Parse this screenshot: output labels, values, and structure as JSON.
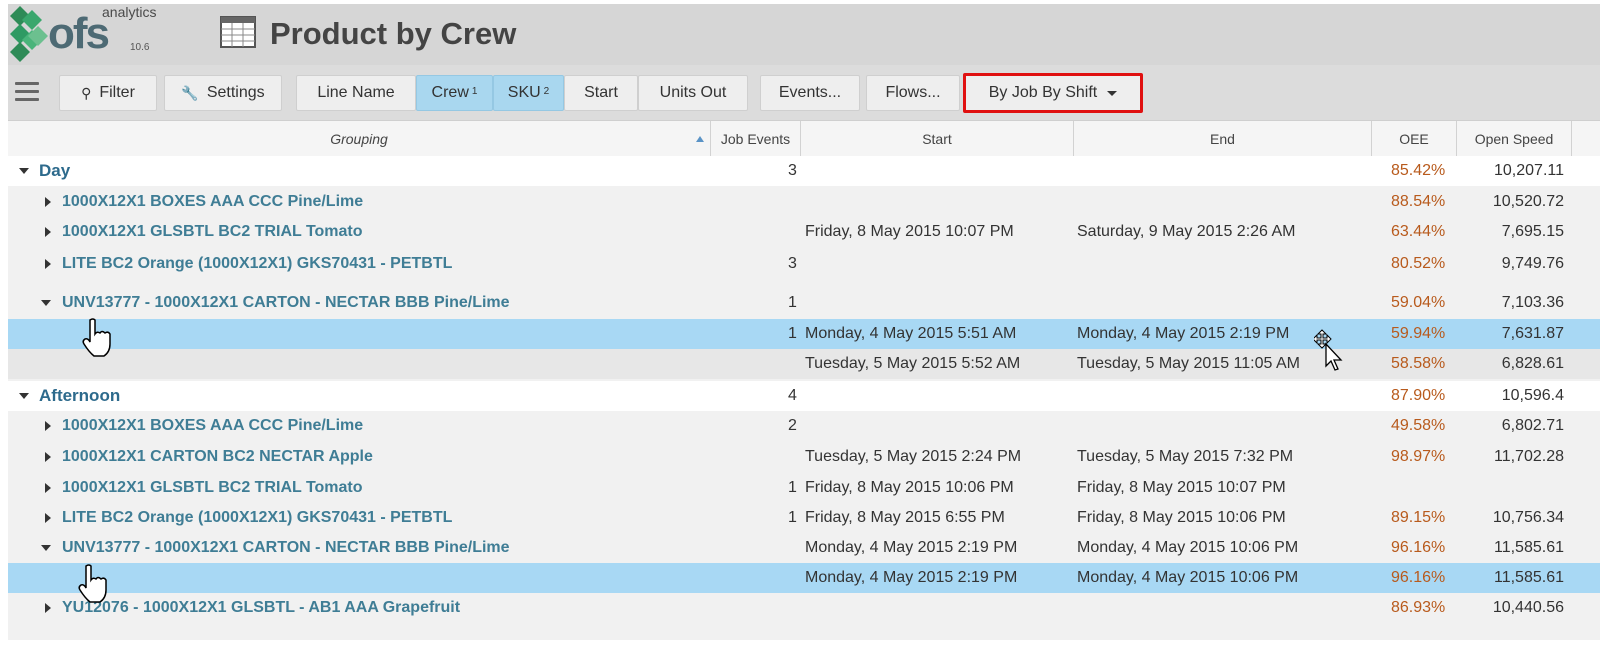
{
  "header": {
    "logo_text": "ofs",
    "logo_sup": "analytics",
    "version": "10.6",
    "title": "Product by Crew"
  },
  "toolbar": {
    "filter": "Filter",
    "settings": "Settings",
    "line_name": "Line Name",
    "crew": "Crew",
    "crew_sup": "1",
    "sku": "SKU",
    "sku_sup": "2",
    "start": "Start",
    "units_out": "Units Out",
    "events": "Events...",
    "flows": "Flows...",
    "view_mode": "By Job By Shift"
  },
  "columns": {
    "grouping": "Grouping",
    "job_events": "Job Events",
    "start": "Start",
    "end": "End",
    "oee": "OEE",
    "open_speed": "Open Speed"
  },
  "rows": [
    {
      "label": "Day",
      "job_events": "3",
      "start": "",
      "end": "",
      "oee": "85.42%",
      "speed": "10,207.11"
    },
    {
      "label": "1000X12X1 BOXES AAA CCC Pine/Lime",
      "job_events": "",
      "start": "",
      "end": "",
      "oee": "88.54%",
      "speed": "10,520.72"
    },
    {
      "label": "1000X12X1 GLSBTL BC2 TRIAL Tomato",
      "job_events": "",
      "start": "Friday, 8 May 2015 10:07 PM",
      "end": "Saturday, 9 May 2015 2:26 AM",
      "oee": "63.44%",
      "speed": "7,695.15"
    },
    {
      "label": "LITE BC2 Orange (1000X12X1) GKS70431 - PETBTL",
      "job_events": "3",
      "start": "",
      "end": "",
      "oee": "80.52%",
      "speed": "9,749.76"
    },
    {
      "label": "UNV13777 - 1000X12X1 CARTON - NECTAR BBB Pine/Lime",
      "job_events": "1",
      "start": "",
      "end": "",
      "oee": "59.04%",
      "speed": "7,103.36"
    },
    {
      "label": "",
      "job_events": "1",
      "start": "Monday, 4 May 2015 5:51 AM",
      "end": "Monday, 4 May 2015 2:19 PM",
      "oee": "59.94%",
      "speed": "7,631.87"
    },
    {
      "label": "",
      "job_events": "",
      "start": "Tuesday, 5 May 2015 5:52 AM",
      "end": "Tuesday, 5 May 2015 11:05 AM",
      "oee": "58.58%",
      "speed": "6,828.61"
    },
    {
      "label": "Afternoon",
      "job_events": "4",
      "start": "",
      "end": "",
      "oee": "87.90%",
      "speed": "10,596.4"
    },
    {
      "label": "1000X12X1 BOXES AAA CCC Pine/Lime",
      "job_events": "2",
      "start": "",
      "end": "",
      "oee": "49.58%",
      "speed": "6,802.71"
    },
    {
      "label": "1000X12X1 CARTON BC2 NECTAR Apple",
      "job_events": "",
      "start": "Tuesday, 5 May 2015 2:24 PM",
      "end": "Tuesday, 5 May 2015 7:32 PM",
      "oee": "98.97%",
      "speed": "11,702.28"
    },
    {
      "label": "1000X12X1 GLSBTL BC2 TRIAL Tomato",
      "job_events": "1",
      "start": "Friday, 8 May 2015 10:06 PM",
      "end": "Friday, 8 May 2015 10:07 PM",
      "oee": "",
      "speed": ""
    },
    {
      "label": "LITE BC2 Orange (1000X12X1) GKS70431 - PETBTL",
      "job_events": "1",
      "start": "Friday, 8 May 2015 6:55 PM",
      "end": "Friday, 8 May 2015 10:06 PM",
      "oee": "89.15%",
      "speed": "10,756.34"
    },
    {
      "label": "UNV13777 - 1000X12X1 CARTON - NECTAR BBB Pine/Lime",
      "job_events": "",
      "start": "Monday, 4 May 2015 2:19 PM",
      "end": "Monday, 4 May 2015 10:06 PM",
      "oee": "96.16%",
      "speed": "11,585.61"
    },
    {
      "label": "",
      "job_events": "",
      "start": "Monday, 4 May 2015 2:19 PM",
      "end": "Monday, 4 May 2015 10:06 PM",
      "oee": "96.16%",
      "speed": "11,585.61"
    },
    {
      "label": "YU12076 - 1000X12X1 GLSBTL - AB1 AAA Grapefruit",
      "job_events": "",
      "start": "",
      "end": "",
      "oee": "86.93%",
      "speed": "10,440.56"
    }
  ]
}
